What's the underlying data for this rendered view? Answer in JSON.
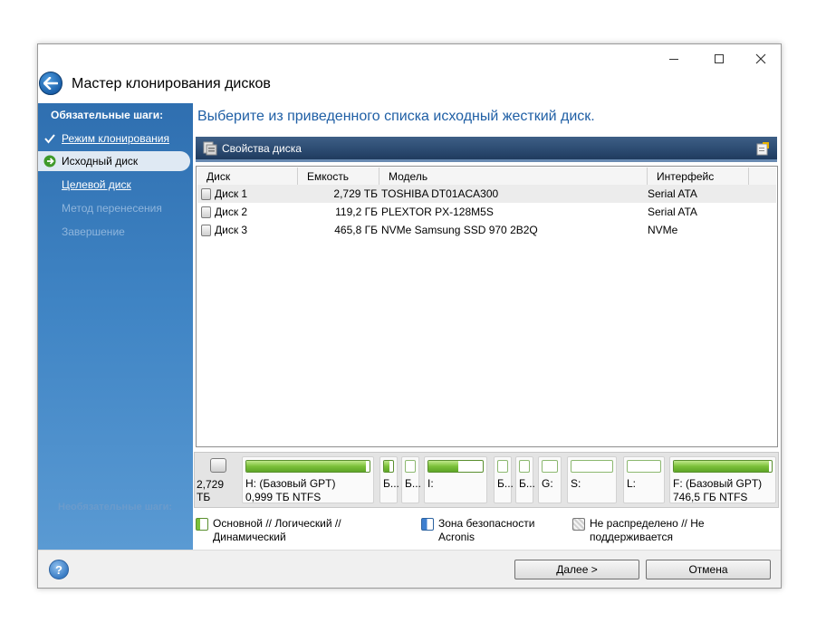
{
  "window": {
    "title": "Мастер клонирования дисков"
  },
  "sidebar": {
    "required_heading": "Обязательные шаги:",
    "items": [
      {
        "label": "Режим клонирования",
        "state": "done"
      },
      {
        "label": "Исходный диск",
        "state": "current"
      },
      {
        "label": "Целевой диск",
        "state": "link"
      },
      {
        "label": "Метод перенесения",
        "state": "disabled"
      },
      {
        "label": "Завершение",
        "state": "disabled"
      }
    ],
    "optional_heading": "Необязательные шаги:"
  },
  "main": {
    "heading": "Выберите из приведенного списка исходный жесткий диск.",
    "toolbar": {
      "disk_properties": "Свойства диска"
    },
    "table": {
      "columns": [
        "Диск",
        "Емкость",
        "Модель",
        "Интерфейс"
      ],
      "rows": [
        {
          "disk": "Диск 1",
          "capacity": "2,729 ТБ",
          "model": "TOSHIBA DT01ACA300",
          "interface": "Serial ATA",
          "selected": true
        },
        {
          "disk": "Диск 2",
          "capacity": "119,2 ГБ",
          "model": "PLEXTOR PX-128M5S",
          "interface": "Serial ATA",
          "selected": false
        },
        {
          "disk": "Диск 3",
          "capacity": "465,8 ГБ",
          "model": "NVMe Samsung SSD 970 2B2Q",
          "interface": "NVMe",
          "selected": false
        }
      ]
    },
    "disk_map": {
      "disk_size": "2,729 ТБ",
      "partitions": [
        {
          "line1": "H: (Базовый GPT)",
          "line2": "0,999 ТБ  NTFS",
          "fill": 0.97
        },
        {
          "line1": "Б...",
          "line2": "",
          "fill": 0.6
        },
        {
          "line1": "Б...",
          "line2": "",
          "fill": 0.0
        },
        {
          "line1": "I:",
          "line2": "",
          "fill": 0.55
        },
        {
          "line1": "Б...",
          "line2": "",
          "fill": 0.0
        },
        {
          "line1": "Б...",
          "line2": "",
          "fill": 0.0
        },
        {
          "line1": "G:",
          "line2": "",
          "fill": 0.0
        },
        {
          "line1": "S:",
          "line2": "",
          "fill": 0.0
        },
        {
          "line1": "L:",
          "line2": "",
          "fill": 0.0
        },
        {
          "line1": "F: (Базовый GPT)",
          "line2": "746,5 ГБ  NTFS",
          "fill": 0.97
        }
      ]
    },
    "legend": {
      "primary": [
        "Основной // Логический //",
        "Динамический"
      ],
      "secure_zone": [
        "Зона безопасности",
        "Acronis"
      ],
      "unallocated": [
        "Не распределено // Не",
        "поддерживается"
      ]
    }
  },
  "footer": {
    "next_label_u": "Д",
    "next_label_rest": "алее >",
    "cancel_label": "Отмена"
  },
  "colors": {
    "sidebar_top": "#2f6fb0",
    "heading": "#1f5fa5",
    "partition_green": "#7cc13a"
  }
}
